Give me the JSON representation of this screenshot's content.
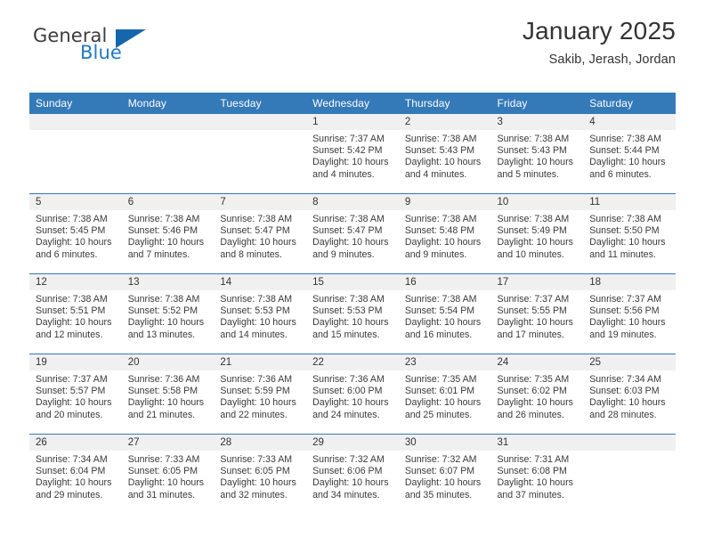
{
  "logo": {
    "word_top": "General",
    "word_bottom": "Blue",
    "triangle_name": "blue-triangle",
    "color_dark": "#3c3c3c",
    "color_blue": "#1f7ac4"
  },
  "header": {
    "title": "January 2025",
    "subtitle": "Sakib, Jerash, Jordan"
  },
  "colors": {
    "header_row_bg": "#3479b8",
    "daynum_strip_bg": "#f0f0f0",
    "text": "#333333",
    "row_divider": "#3479b8"
  },
  "calendar": {
    "weekday_headers": [
      "Sunday",
      "Monday",
      "Tuesday",
      "Wednesday",
      "Thursday",
      "Friday",
      "Saturday"
    ],
    "weeks": [
      [
        {
          "day": "",
          "empty": true,
          "sunrise": "",
          "sunset": "",
          "daylight_line1": "",
          "daylight_line2": ""
        },
        {
          "day": "",
          "empty": true,
          "sunrise": "",
          "sunset": "",
          "daylight_line1": "",
          "daylight_line2": ""
        },
        {
          "day": "",
          "empty": true,
          "sunrise": "",
          "sunset": "",
          "daylight_line1": "",
          "daylight_line2": ""
        },
        {
          "day": "1",
          "empty": false,
          "sunrise": "Sunrise: 7:37 AM",
          "sunset": "Sunset: 5:42 PM",
          "daylight_line1": "Daylight: 10 hours",
          "daylight_line2": "and 4 minutes."
        },
        {
          "day": "2",
          "empty": false,
          "sunrise": "Sunrise: 7:38 AM",
          "sunset": "Sunset: 5:43 PM",
          "daylight_line1": "Daylight: 10 hours",
          "daylight_line2": "and 4 minutes."
        },
        {
          "day": "3",
          "empty": false,
          "sunrise": "Sunrise: 7:38 AM",
          "sunset": "Sunset: 5:43 PM",
          "daylight_line1": "Daylight: 10 hours",
          "daylight_line2": "and 5 minutes."
        },
        {
          "day": "4",
          "empty": false,
          "sunrise": "Sunrise: 7:38 AM",
          "sunset": "Sunset: 5:44 PM",
          "daylight_line1": "Daylight: 10 hours",
          "daylight_line2": "and 6 minutes."
        }
      ],
      [
        {
          "day": "5",
          "empty": false,
          "sunrise": "Sunrise: 7:38 AM",
          "sunset": "Sunset: 5:45 PM",
          "daylight_line1": "Daylight: 10 hours",
          "daylight_line2": "and 6 minutes."
        },
        {
          "day": "6",
          "empty": false,
          "sunrise": "Sunrise: 7:38 AM",
          "sunset": "Sunset: 5:46 PM",
          "daylight_line1": "Daylight: 10 hours",
          "daylight_line2": "and 7 minutes."
        },
        {
          "day": "7",
          "empty": false,
          "sunrise": "Sunrise: 7:38 AM",
          "sunset": "Sunset: 5:47 PM",
          "daylight_line1": "Daylight: 10 hours",
          "daylight_line2": "and 8 minutes."
        },
        {
          "day": "8",
          "empty": false,
          "sunrise": "Sunrise: 7:38 AM",
          "sunset": "Sunset: 5:47 PM",
          "daylight_line1": "Daylight: 10 hours",
          "daylight_line2": "and 9 minutes."
        },
        {
          "day": "9",
          "empty": false,
          "sunrise": "Sunrise: 7:38 AM",
          "sunset": "Sunset: 5:48 PM",
          "daylight_line1": "Daylight: 10 hours",
          "daylight_line2": "and 9 minutes."
        },
        {
          "day": "10",
          "empty": false,
          "sunrise": "Sunrise: 7:38 AM",
          "sunset": "Sunset: 5:49 PM",
          "daylight_line1": "Daylight: 10 hours",
          "daylight_line2": "and 10 minutes."
        },
        {
          "day": "11",
          "empty": false,
          "sunrise": "Sunrise: 7:38 AM",
          "sunset": "Sunset: 5:50 PM",
          "daylight_line1": "Daylight: 10 hours",
          "daylight_line2": "and 11 minutes."
        }
      ],
      [
        {
          "day": "12",
          "empty": false,
          "sunrise": "Sunrise: 7:38 AM",
          "sunset": "Sunset: 5:51 PM",
          "daylight_line1": "Daylight: 10 hours",
          "daylight_line2": "and 12 minutes."
        },
        {
          "day": "13",
          "empty": false,
          "sunrise": "Sunrise: 7:38 AM",
          "sunset": "Sunset: 5:52 PM",
          "daylight_line1": "Daylight: 10 hours",
          "daylight_line2": "and 13 minutes."
        },
        {
          "day": "14",
          "empty": false,
          "sunrise": "Sunrise: 7:38 AM",
          "sunset": "Sunset: 5:53 PM",
          "daylight_line1": "Daylight: 10 hours",
          "daylight_line2": "and 14 minutes."
        },
        {
          "day": "15",
          "empty": false,
          "sunrise": "Sunrise: 7:38 AM",
          "sunset": "Sunset: 5:53 PM",
          "daylight_line1": "Daylight: 10 hours",
          "daylight_line2": "and 15 minutes."
        },
        {
          "day": "16",
          "empty": false,
          "sunrise": "Sunrise: 7:38 AM",
          "sunset": "Sunset: 5:54 PM",
          "daylight_line1": "Daylight: 10 hours",
          "daylight_line2": "and 16 minutes."
        },
        {
          "day": "17",
          "empty": false,
          "sunrise": "Sunrise: 7:37 AM",
          "sunset": "Sunset: 5:55 PM",
          "daylight_line1": "Daylight: 10 hours",
          "daylight_line2": "and 17 minutes."
        },
        {
          "day": "18",
          "empty": false,
          "sunrise": "Sunrise: 7:37 AM",
          "sunset": "Sunset: 5:56 PM",
          "daylight_line1": "Daylight: 10 hours",
          "daylight_line2": "and 19 minutes."
        }
      ],
      [
        {
          "day": "19",
          "empty": false,
          "sunrise": "Sunrise: 7:37 AM",
          "sunset": "Sunset: 5:57 PM",
          "daylight_line1": "Daylight: 10 hours",
          "daylight_line2": "and 20 minutes."
        },
        {
          "day": "20",
          "empty": false,
          "sunrise": "Sunrise: 7:36 AM",
          "sunset": "Sunset: 5:58 PM",
          "daylight_line1": "Daylight: 10 hours",
          "daylight_line2": "and 21 minutes."
        },
        {
          "day": "21",
          "empty": false,
          "sunrise": "Sunrise: 7:36 AM",
          "sunset": "Sunset: 5:59 PM",
          "daylight_line1": "Daylight: 10 hours",
          "daylight_line2": "and 22 minutes."
        },
        {
          "day": "22",
          "empty": false,
          "sunrise": "Sunrise: 7:36 AM",
          "sunset": "Sunset: 6:00 PM",
          "daylight_line1": "Daylight: 10 hours",
          "daylight_line2": "and 24 minutes."
        },
        {
          "day": "23",
          "empty": false,
          "sunrise": "Sunrise: 7:35 AM",
          "sunset": "Sunset: 6:01 PM",
          "daylight_line1": "Daylight: 10 hours",
          "daylight_line2": "and 25 minutes."
        },
        {
          "day": "24",
          "empty": false,
          "sunrise": "Sunrise: 7:35 AM",
          "sunset": "Sunset: 6:02 PM",
          "daylight_line1": "Daylight: 10 hours",
          "daylight_line2": "and 26 minutes."
        },
        {
          "day": "25",
          "empty": false,
          "sunrise": "Sunrise: 7:34 AM",
          "sunset": "Sunset: 6:03 PM",
          "daylight_line1": "Daylight: 10 hours",
          "daylight_line2": "and 28 minutes."
        }
      ],
      [
        {
          "day": "26",
          "empty": false,
          "sunrise": "Sunrise: 7:34 AM",
          "sunset": "Sunset: 6:04 PM",
          "daylight_line1": "Daylight: 10 hours",
          "daylight_line2": "and 29 minutes."
        },
        {
          "day": "27",
          "empty": false,
          "sunrise": "Sunrise: 7:33 AM",
          "sunset": "Sunset: 6:05 PM",
          "daylight_line1": "Daylight: 10 hours",
          "daylight_line2": "and 31 minutes."
        },
        {
          "day": "28",
          "empty": false,
          "sunrise": "Sunrise: 7:33 AM",
          "sunset": "Sunset: 6:05 PM",
          "daylight_line1": "Daylight: 10 hours",
          "daylight_line2": "and 32 minutes."
        },
        {
          "day": "29",
          "empty": false,
          "sunrise": "Sunrise: 7:32 AM",
          "sunset": "Sunset: 6:06 PM",
          "daylight_line1": "Daylight: 10 hours",
          "daylight_line2": "and 34 minutes."
        },
        {
          "day": "30",
          "empty": false,
          "sunrise": "Sunrise: 7:32 AM",
          "sunset": "Sunset: 6:07 PM",
          "daylight_line1": "Daylight: 10 hours",
          "daylight_line2": "and 35 minutes."
        },
        {
          "day": "31",
          "empty": false,
          "sunrise": "Sunrise: 7:31 AM",
          "sunset": "Sunset: 6:08 PM",
          "daylight_line1": "Daylight: 10 hours",
          "daylight_line2": "and 37 minutes."
        },
        {
          "day": "",
          "empty": true,
          "sunrise": "",
          "sunset": "",
          "daylight_line1": "",
          "daylight_line2": ""
        }
      ]
    ]
  }
}
